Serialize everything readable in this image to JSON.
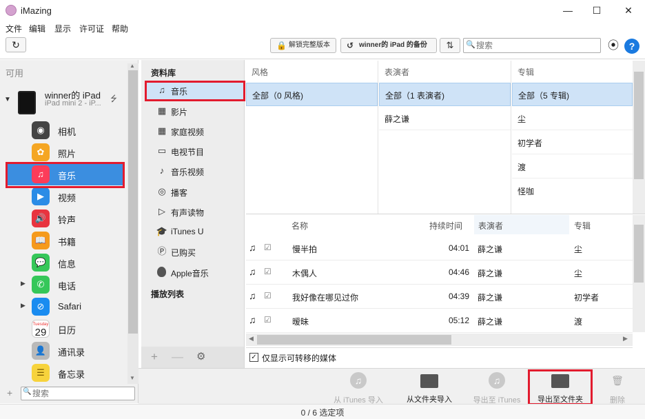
{
  "app": {
    "title": "iMazing"
  },
  "window": {
    "minimize": "—",
    "maximize": "☐",
    "close": "✕"
  },
  "menu": [
    "文件",
    "编辑",
    "显示",
    "许可证",
    "帮助"
  ],
  "toolbar": {
    "unlock_label": "解锁完整版本",
    "backup_label": "winner的 iPad 的备份",
    "search_placeholder": "搜索"
  },
  "sidebar": {
    "header": "可用",
    "device": {
      "name": "winner的 iPad",
      "model": "iPad mini 2 - iP..."
    },
    "items": [
      {
        "label": "相机",
        "icon": "camera-icon",
        "color": "#444444"
      },
      {
        "label": "照片",
        "icon": "photos-icon",
        "color": "#f5a623"
      },
      {
        "label": "音乐",
        "icon": "music-icon",
        "color": "#fc3c5a",
        "selected": true
      },
      {
        "label": "视频",
        "icon": "video-icon",
        "color": "#2b8ce6"
      },
      {
        "label": "铃声",
        "icon": "ringtone-icon",
        "color": "#e8343f"
      },
      {
        "label": "书籍",
        "icon": "books-icon",
        "color": "#f59a1c"
      },
      {
        "label": "信息",
        "icon": "messages-icon",
        "color": "#35c759"
      },
      {
        "label": "电话",
        "icon": "phone-icon",
        "color": "#35c759",
        "expandable": true
      },
      {
        "label": "Safari",
        "icon": "safari-icon",
        "color": "#1a8cf0",
        "expandable": true
      },
      {
        "label": "日历",
        "icon": "calendar-icon",
        "color": "#ffffff",
        "day": "29",
        "weekday": "Tuesday"
      },
      {
        "label": "通讯录",
        "icon": "contacts-icon",
        "color": "#b9b9b9"
      },
      {
        "label": "备忘录",
        "icon": "notes-icon",
        "color": "#f7d33c"
      }
    ],
    "search_placeholder": "搜索"
  },
  "library": {
    "header": "资料库",
    "items": [
      {
        "label": "音乐",
        "icon": "music-note-icon",
        "selected": true
      },
      {
        "label": "影片",
        "icon": "film-icon"
      },
      {
        "label": "家庭视频",
        "icon": "home-video-icon"
      },
      {
        "label": "电视节目",
        "icon": "tv-icon"
      },
      {
        "label": "音乐视频",
        "icon": "music-video-icon"
      },
      {
        "label": "播客",
        "icon": "podcast-icon"
      },
      {
        "label": "有声读物",
        "icon": "audiobook-icon"
      },
      {
        "label": "iTunes U",
        "icon": "itunes-u-icon"
      },
      {
        "label": "已购买",
        "icon": "purchased-icon"
      },
      {
        "label": "Apple音乐",
        "icon": "apple-icon"
      }
    ],
    "playlists_header": "播放列表"
  },
  "browser": {
    "columns": [
      {
        "header": "风格",
        "selected": "全部（0 风格)",
        "items": []
      },
      {
        "header": "表演者",
        "selected": "全部（1 表演者)",
        "items": [
          "薛之谦"
        ]
      },
      {
        "header": "专辑",
        "selected": "全部（5 专辑)",
        "items": [
          "尘",
          "初学者",
          "渡",
          "怪咖"
        ]
      }
    ]
  },
  "tracks": {
    "headers": {
      "name": "名称",
      "duration": "持续时间",
      "artist": "表演者",
      "album": "专辑"
    },
    "rows": [
      {
        "name": "慢半拍",
        "duration": "04:01",
        "artist": "薛之谦",
        "album": "尘"
      },
      {
        "name": "木偶人",
        "duration": "04:46",
        "artist": "薛之谦",
        "album": "尘"
      },
      {
        "name": "我好像在哪见过你",
        "duration": "04:39",
        "artist": "薛之谦",
        "album": "初学者"
      },
      {
        "name": "暧昧",
        "duration": "05:12",
        "artist": "薛之谦",
        "album": "渡"
      }
    ],
    "only_transferable": "仅显示可转移的媒体"
  },
  "actions": [
    {
      "label": "从 iTunes 导入",
      "icon": "itunes-import-icon",
      "enabled": false
    },
    {
      "label": "从文件夹导入",
      "icon": "folder-import-icon",
      "enabled": true
    },
    {
      "label": "导出至 iTunes",
      "icon": "itunes-export-icon",
      "enabled": false
    },
    {
      "label": "导出至文件夹",
      "icon": "folder-export-icon",
      "enabled": true
    },
    {
      "label": "删除",
      "icon": "trash-icon",
      "enabled": false
    }
  ],
  "status": {
    "selection": "0 / 6 选定项"
  },
  "colors": {
    "highlight": "#e21b2e",
    "selection": "#3b8ee0",
    "light_selection": "#cfe3f7"
  }
}
